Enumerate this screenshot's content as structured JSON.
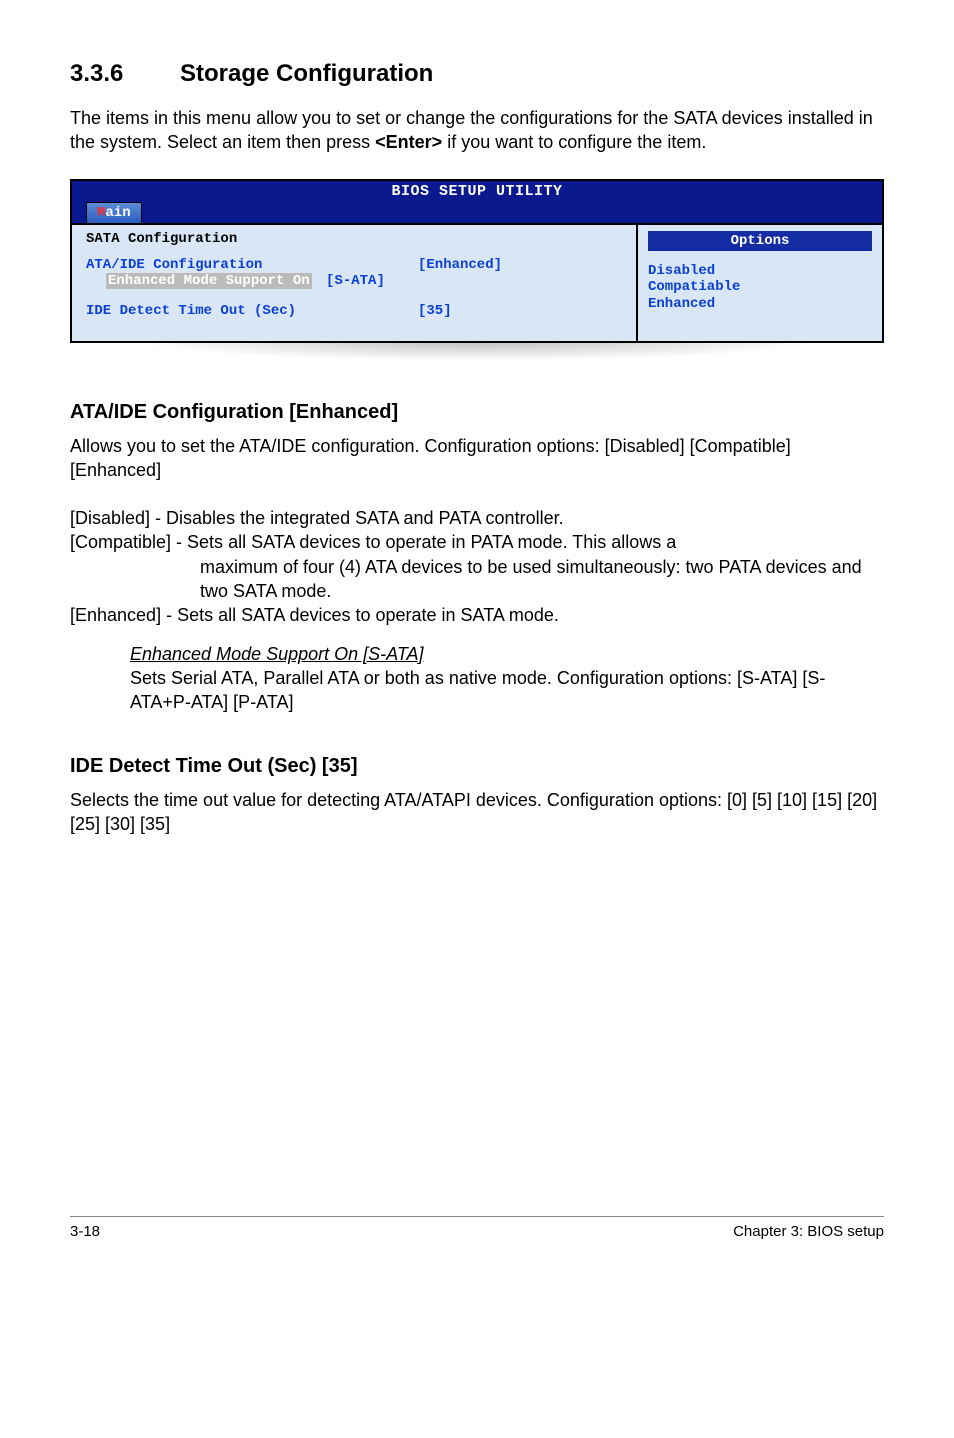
{
  "section": {
    "number": "3.3.6",
    "title": "Storage Configuration"
  },
  "intro": {
    "part1": "The items in this menu allow you to set or change the configurations for the SATA devices installed in the system. Select an item then press ",
    "enter": "<Enter>",
    "part2": " if you want to configure the item."
  },
  "bios": {
    "utility_title": "BIOS SETUP UTILITY",
    "tab_hot": "M",
    "tab_rest": "ain",
    "panel_title": "SATA Configuration",
    "rows": {
      "ata_label": "ATA/IDE Configuration",
      "ata_value": "[Enhanced]",
      "enh_label": "Enhanced Mode Support On",
      "enh_value": "[S-ATA]",
      "ide_label": "IDE Detect Time Out (Sec)",
      "ide_value": "[35]"
    },
    "options": {
      "header": "Options",
      "items": [
        "Disabled",
        "Compatiable",
        "Enhanced"
      ]
    }
  },
  "ata_section": {
    "heading": "ATA/IDE Configuration [Enhanced]",
    "p1": "Allows you to set the ATA/IDE configuration. Configuration options: [Disabled] [Compatible] [Enhanced]",
    "disabled": "[Disabled] - Disables the integrated SATA and PATA controller.",
    "compatible_lead": "[Compatible] - Sets all SATA devices to operate in PATA mode. This allows a",
    "compatible_cont": "maximum of four (4) ATA devices to be used simultaneously: two PATA devices and two SATA mode.",
    "enhanced": "[Enhanced] - Sets all SATA devices to operate in SATA mode.",
    "sub_heading": "Enhanced Mode Support On [S-ATA]",
    "sub_body": "Sets Serial ATA, Parallel ATA or both as native mode. Configuration options: [S-ATA] [S-ATA+P-ATA] [P-ATA]"
  },
  "ide_section": {
    "heading": "IDE Detect Time Out (Sec) [35]",
    "body": "Selects the time out value for detecting ATA/ATAPI devices. Configuration options: [0] [5] [10] [15] [20] [25] [30] [35]"
  },
  "footer": {
    "left": "3-18",
    "right": "Chapter 3: BIOS setup"
  }
}
